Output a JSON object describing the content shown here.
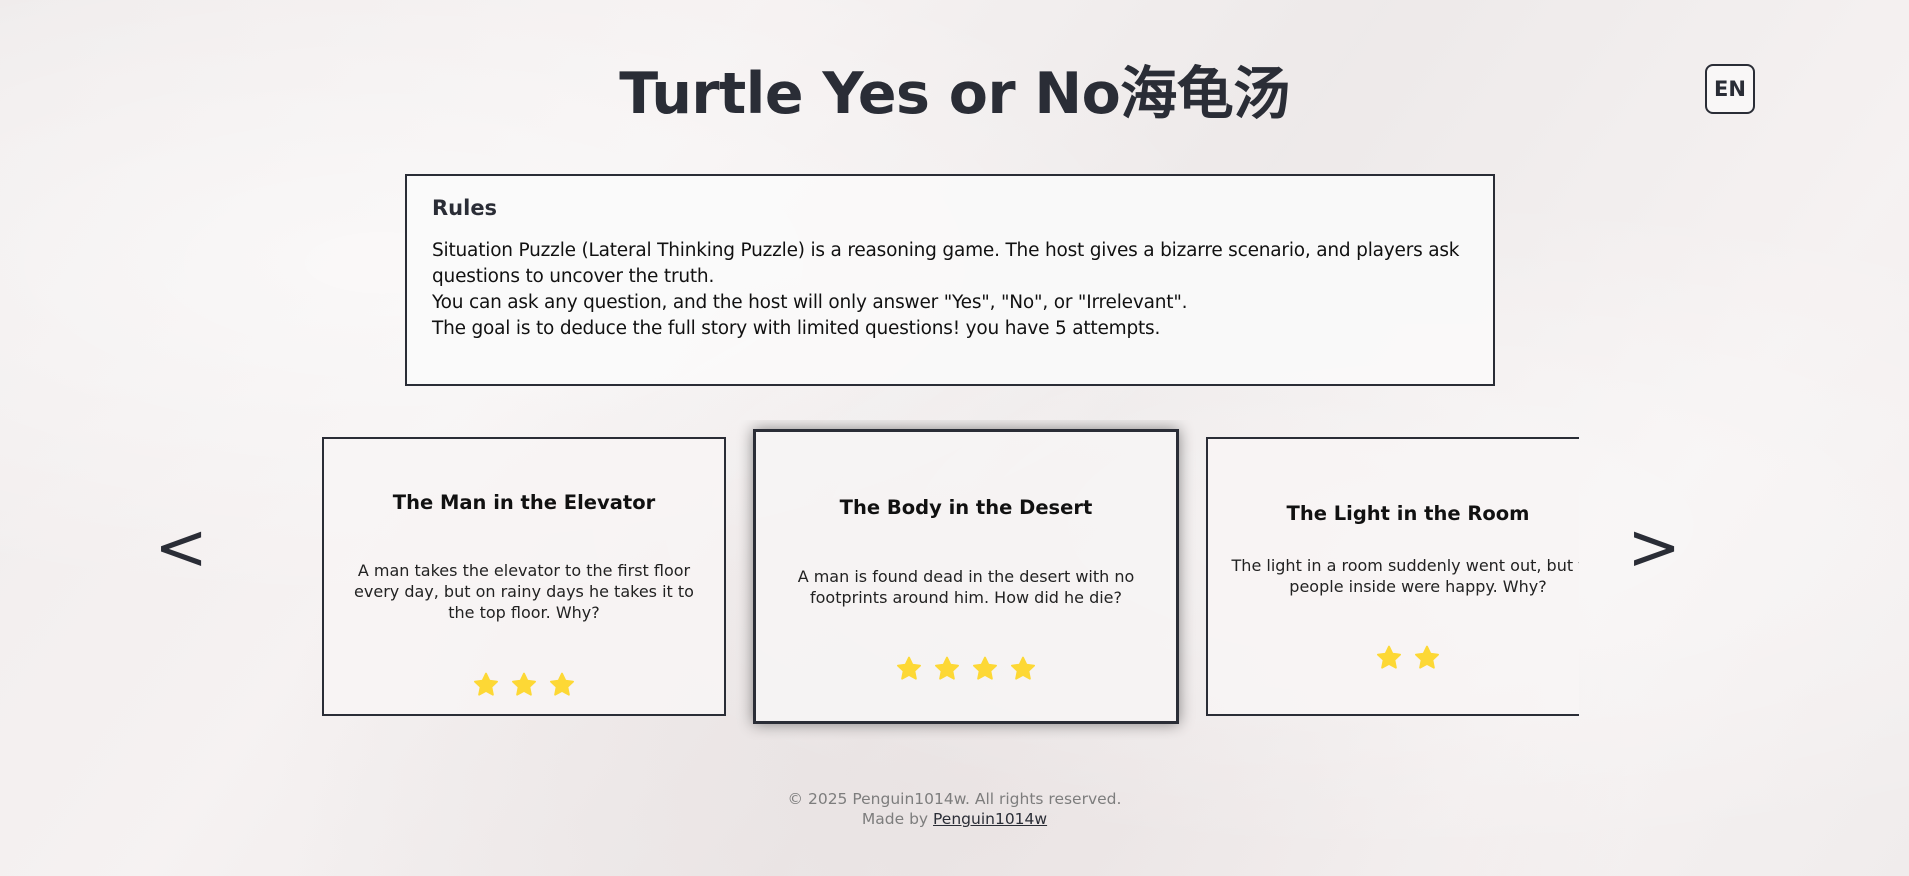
{
  "header": {
    "title": "Turtle Yes or No海龟汤",
    "lang_button": "EN"
  },
  "rules": {
    "heading": "Rules",
    "lines": [
      "Situation Puzzle (Lateral Thinking Puzzle) is a reasoning game. The host gives a bizarre scenario, and players ask questions to uncover the truth.",
      "You can ask any question, and the host will only answer \"Yes\", \"No\", or \"Irrelevant\".",
      "The goal is to deduce the full story with limited questions! you have 5 attempts."
    ]
  },
  "carousel": {
    "prev_label": "<",
    "next_label": ">",
    "star_color": "#fdd835",
    "cards": [
      {
        "title": "The Man in the Elevator",
        "description": "A man takes the elevator to the first floor every day, but on rainy days he takes it to the top floor. Why?",
        "difficulty": 3
      },
      {
        "title": "The Body in the Desert",
        "description": "A man is found dead in the desert with no footprints around him. How did he die?",
        "difficulty": 4,
        "active": true
      },
      {
        "title": "The Light in the Room",
        "description": "The light in a room suddenly went out, but the people inside were happy. Why?",
        "difficulty": 2
      }
    ]
  },
  "footer": {
    "copyright": "© 2025 Penguin1014w. All rights reserved.",
    "made_by_prefix": "Made by",
    "author_link": "Penguin1014w"
  }
}
